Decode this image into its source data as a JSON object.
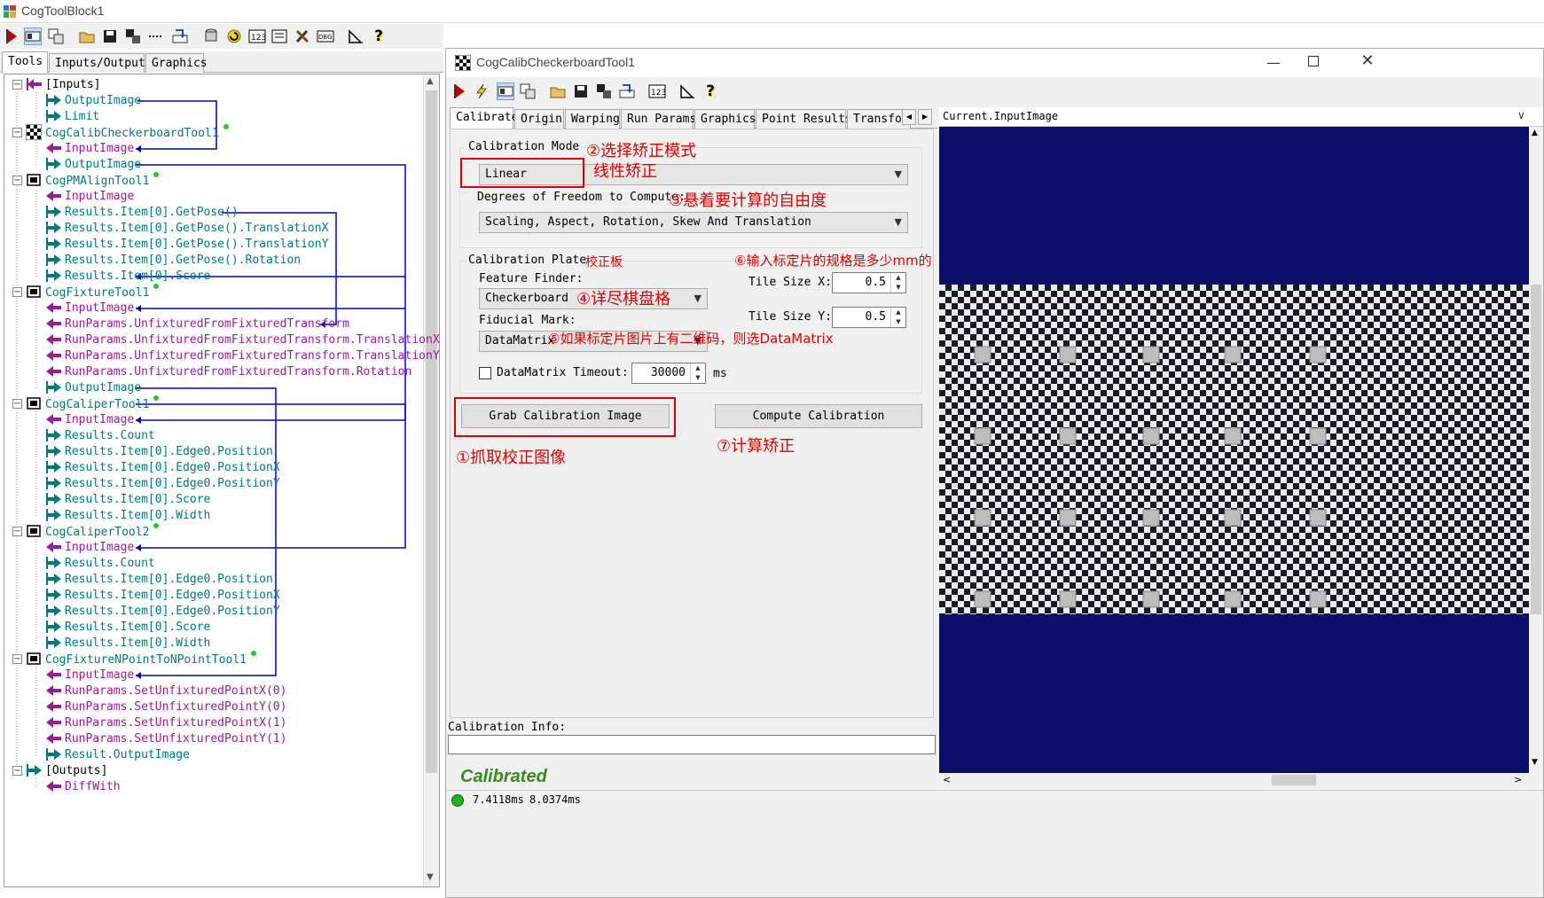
{
  "main_window": {
    "title": "CogToolBlock1"
  },
  "left_tabs": [
    "Tools",
    "Inputs/Outputs",
    "Graphics"
  ],
  "tree": [
    {
      "label": "[Inputs]",
      "kind": "group",
      "color": "#000000"
    },
    {
      "label": "OutputImage",
      "kind": "out",
      "color": "#007a7a"
    },
    {
      "label": "Limit",
      "kind": "out",
      "color": "#007a7a"
    },
    {
      "label": "CogCalibCheckerboardTool1",
      "kind": "tool",
      "color": "#007a7a"
    },
    {
      "label": "InputImage",
      "kind": "in",
      "color": "#9b1a9b"
    },
    {
      "label": "OutputImage",
      "kind": "out",
      "color": "#007a7a"
    },
    {
      "label": "CogPMAlignTool1",
      "kind": "tool",
      "color": "#007a7a"
    },
    {
      "label": "InputImage",
      "kind": "in",
      "color": "#9b1a9b"
    },
    {
      "label": "Results.Item[0].GetPose()",
      "kind": "out",
      "color": "#007a7a"
    },
    {
      "label": "Results.Item[0].GetPose().TranslationX",
      "kind": "out",
      "color": "#007a7a"
    },
    {
      "label": "Results.Item[0].GetPose().TranslationY",
      "kind": "out",
      "color": "#007a7a"
    },
    {
      "label": "Results.Item[0].GetPose().Rotation",
      "kind": "out",
      "color": "#007a7a"
    },
    {
      "label": "Results.Item[0].Score",
      "kind": "out",
      "color": "#007a7a"
    },
    {
      "label": "CogFixtureTool1",
      "kind": "tool",
      "color": "#007a7a"
    },
    {
      "label": "InputImage",
      "kind": "in",
      "color": "#9b1a9b"
    },
    {
      "label": "RunParams.UnfixturedFromFixturedTransform",
      "kind": "in",
      "color": "#9b1a9b"
    },
    {
      "label": "RunParams.UnfixturedFromFixturedTransform.TranslationX",
      "kind": "in",
      "color": "#9b1a9b"
    },
    {
      "label": "RunParams.UnfixturedFromFixturedTransform.TranslationY",
      "kind": "in",
      "color": "#9b1a9b"
    },
    {
      "label": "RunParams.UnfixturedFromFixturedTransform.Rotation",
      "kind": "in",
      "color": "#9b1a9b"
    },
    {
      "label": "OutputImage",
      "kind": "out",
      "color": "#007a7a"
    },
    {
      "label": "CogCaliperTool1",
      "kind": "tool",
      "color": "#007a7a"
    },
    {
      "label": "InputImage",
      "kind": "in",
      "color": "#9b1a9b"
    },
    {
      "label": "Results.Count",
      "kind": "out",
      "color": "#007a7a"
    },
    {
      "label": "Results.Item[0].Edge0.Position",
      "kind": "out",
      "color": "#007a7a"
    },
    {
      "label": "Results.Item[0].Edge0.PositionX",
      "kind": "out",
      "color": "#007a7a"
    },
    {
      "label": "Results.Item[0].Edge0.PositionY",
      "kind": "out",
      "color": "#007a7a"
    },
    {
      "label": "Results.Item[0].Score",
      "kind": "out",
      "color": "#007a7a"
    },
    {
      "label": "Results.Item[0].Width",
      "kind": "out",
      "color": "#007a7a"
    },
    {
      "label": "CogCaliperTool2",
      "kind": "tool",
      "color": "#007a7a"
    },
    {
      "label": "InputImage",
      "kind": "in",
      "color": "#9b1a9b"
    },
    {
      "label": "Results.Count",
      "kind": "out",
      "color": "#007a7a"
    },
    {
      "label": "Results.Item[0].Edge0.Position",
      "kind": "out",
      "color": "#007a7a"
    },
    {
      "label": "Results.Item[0].Edge0.PositionX",
      "kind": "out",
      "color": "#007a7a"
    },
    {
      "label": "Results.Item[0].Edge0.PositionY",
      "kind": "out",
      "color": "#007a7a"
    },
    {
      "label": "Results.Item[0].Score",
      "kind": "out",
      "color": "#007a7a"
    },
    {
      "label": "Results.Item[0].Width",
      "kind": "out",
      "color": "#007a7a"
    },
    {
      "label": "CogFixtureNPointToNPointTool1",
      "kind": "tool",
      "color": "#007a7a"
    },
    {
      "label": "InputImage",
      "kind": "in",
      "color": "#9b1a9b"
    },
    {
      "label": "RunParams.SetUnfixturedPointX(0)",
      "kind": "in",
      "color": "#9b1a9b"
    },
    {
      "label": "RunParams.SetUnfixturedPointY(0)",
      "kind": "in",
      "color": "#9b1a9b"
    },
    {
      "label": "RunParams.SetUnfixturedPointX(1)",
      "kind": "in",
      "color": "#9b1a9b"
    },
    {
      "label": "RunParams.SetUnfixturedPointY(1)",
      "kind": "in",
      "color": "#9b1a9b"
    },
    {
      "label": "Result.OutputImage",
      "kind": "out",
      "color": "#007a7a"
    },
    {
      "label": "[Outputs]",
      "kind": "group",
      "color": "#000000"
    },
    {
      "label": "DiffWith",
      "kind": "in",
      "color": "#9b1a9b"
    }
  ],
  "calib_window": {
    "title": "CogCalibCheckerboardTool1",
    "tabs": [
      "Calibrate",
      "Origin",
      "Warping",
      "Run Params",
      "Graphics",
      "Point Results",
      "Transform"
    ],
    "image_selector": "Current.InputImage",
    "calibration_mode_label": "Calibration Mode",
    "calibration_mode_value": "Linear",
    "dof_label": "Degrees of Freedom to Compute:",
    "dof_value": "Scaling, Aspect, Rotation, Skew And Translation",
    "plate_label": "Calibration Plate",
    "feature_finder_label": "Feature Finder:",
    "feature_finder_value": "Checkerboard",
    "fiducial_label": "Fiducial Mark:",
    "fiducial_value": "DataMatrix",
    "tile_x_label": "Tile Size X:",
    "tile_x_value": "0.5",
    "tile_y_label": "Tile Size Y:",
    "tile_y_value": "0.5",
    "timeout_label": "DataMatrix Timeout:",
    "timeout_value": "30000",
    "timeout_unit": "ms",
    "grab_button": "Grab Calibration Image",
    "compute_button": "Compute Calibration",
    "info_label": "Calibration Info:",
    "status": "Calibrated",
    "timing1": "7.4118ms",
    "timing2": "8.0374ms"
  },
  "annotations": {
    "a1": "①抓取校正图像",
    "a2": "②选择矫正模式",
    "a2b": "线性矫正",
    "a3": "③悬着要计算的自由度",
    "a4": "④详尽棋盘格",
    "a5": "⑤如果标定片图片上有二维码，则选DataMatrix",
    "a6": "⑥输入标定片的规格是多少mm的",
    "a7": "⑦计算矫正",
    "plate_cn": "校正板"
  },
  "colors": {
    "link_blue": "#0000cc",
    "image_bg": "#0b0f6b",
    "annotation_red": "#e00000",
    "status_green": "#3a8a1e",
    "run_red": "#c00000"
  }
}
